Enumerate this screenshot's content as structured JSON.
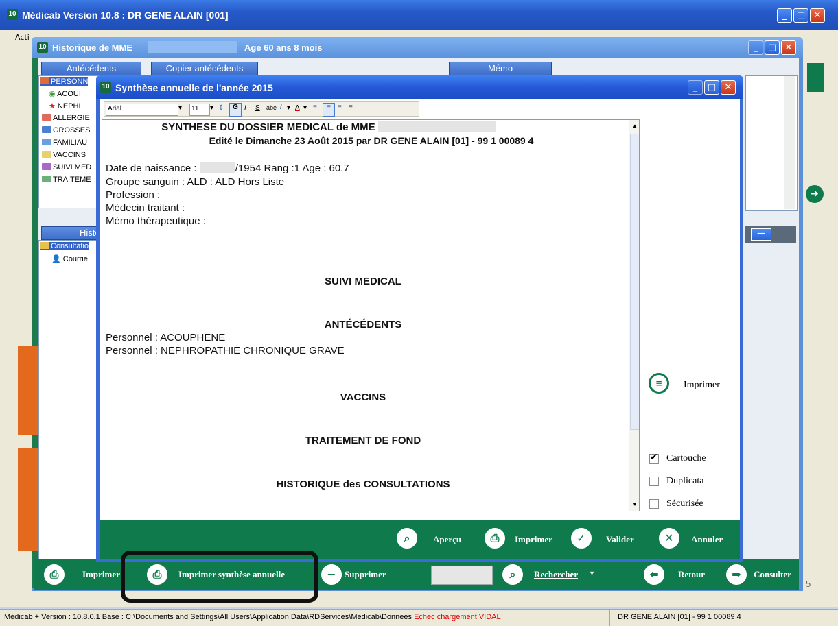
{
  "main_window": {
    "icon": "10",
    "title": "Médicab Version 10.8 : DR GENE ALAIN [001]",
    "menu_label": "Acti"
  },
  "historique_window": {
    "icon": "10",
    "title": "Historique de MME",
    "age": "Age 60 ans 8 mois",
    "tab_antecedents": "Antécédents",
    "tab_copier": "Copier antécédents",
    "tab_memo": "Mémo",
    "antecedent_tree": [
      "PERSONN",
      "ACOUI",
      "NEPHI",
      "ALLERGIE",
      "GROSSES",
      "FAMILIAU",
      "VACCINS",
      "SUIVI MED",
      "TRAITEME"
    ],
    "history_tab": "Histor",
    "history_tree": [
      "Consultatio",
      "Courrie"
    ],
    "toolbar": {
      "print_label": "Imprimer",
      "print_annual_label": "Imprimer synthèse annuelle",
      "delete_label": "Supprimer",
      "search_label": "Rechercher",
      "back_label": "Retour",
      "consult_label": "Consulter",
      "page_digit": "5"
    }
  },
  "synthese_dialog": {
    "icon": "10",
    "title": "Synthèse annuelle de l'année 2015",
    "format_bar": {
      "font": "Arial",
      "size": "11",
      "bold": "G",
      "italic": "I",
      "underline": "S",
      "strike": "abe",
      "color_a": "A"
    },
    "document": {
      "title": "SYNTHESE DU DOSSIER MEDICAL de MME",
      "edited": "Edité le Dimanche 23 Août 2015 par DR GENE ALAIN [01] - 99 1 00089 4",
      "birth_label": "Date de naissance :",
      "birth_value": "/1954  Rang :1 Age : 60.7",
      "blood_group": "Groupe sanguin :    ALD : ALD Hors Liste",
      "profession": "Profession :",
      "doctor": "Médecin traitant :",
      "memo": "Mémo thérapeutique :",
      "section_suivi": "SUIVI MEDICAL",
      "section_antecedents": "ANTÉCÉDENTS",
      "antecedent_1": "Personnel : ACOUPHENE",
      "antecedent_2": "Personnel : NEPHROPATHIE CHRONIQUE GRAVE",
      "section_vaccins": "VACCINS",
      "section_traitement": "TRAITEMENT DE FOND",
      "section_historique": "HISTORIQUE des CONSULTATIONS"
    },
    "side_print_label": "Imprimer",
    "options": {
      "cartouche_label": "Cartouche",
      "cartouche_checked": true,
      "duplicata_label": "Duplicata",
      "duplicata_checked": false,
      "securisee_label": "Sécurisée",
      "securisee_checked": false
    },
    "footer": {
      "apercu_label": "Aperçu",
      "imprimer_label": "Imprimer",
      "valider_label": "Valider",
      "annuler_label": "Annuler"
    }
  },
  "status_bar": {
    "version_path": "Médicab + Version : 10.8.0.1  Base : C:\\Documents and Settings\\All Users\\Application Data\\RDServices\\Medicab\\Donnees",
    "vidal_error": "Echec chargement VIDAL",
    "doctor": "DR GENE ALAIN [01] - 99 1 00089 4"
  },
  "colors": {
    "titlebar_blue": "#2659c8",
    "toolbar_green": "#0f7a4c",
    "error_red": "#e00000"
  }
}
